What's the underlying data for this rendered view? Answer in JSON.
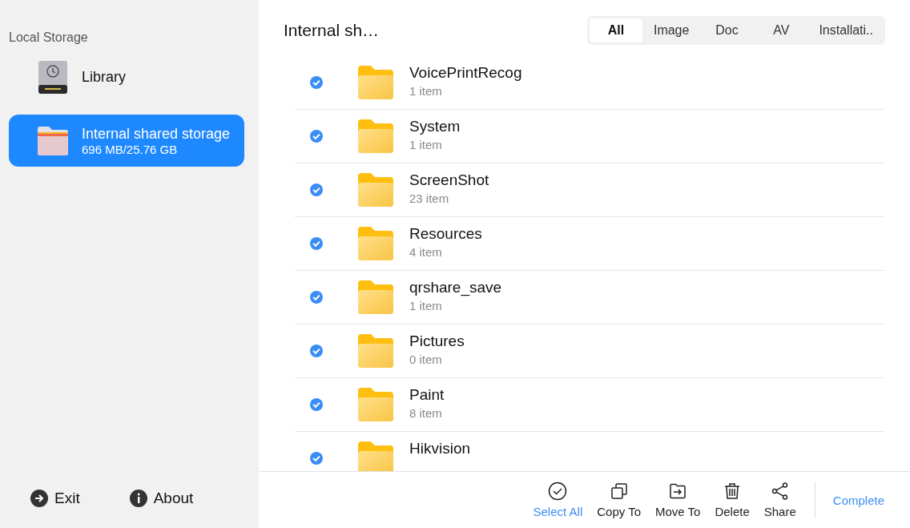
{
  "sidebar": {
    "heading": "Local Storage",
    "items": [
      {
        "kind": "library",
        "label": "Library",
        "selected": false
      },
      {
        "kind": "storage",
        "label": "Internal shared storage",
        "detail": "696 MB/25.76 GB",
        "selected": true
      }
    ],
    "footer": [
      {
        "kind": "exit",
        "label": "Exit"
      },
      {
        "kind": "about",
        "label": "About"
      }
    ]
  },
  "header": {
    "title": "Internal sh…",
    "tabs": [
      {
        "label": "All",
        "selected": true
      },
      {
        "label": "Image",
        "selected": false
      },
      {
        "label": "Doc",
        "selected": false
      },
      {
        "label": "AV",
        "selected": false
      },
      {
        "label": "Installati..",
        "selected": false
      }
    ]
  },
  "files": [
    {
      "name": "VoicePrintRecog",
      "detail": "1 item",
      "checked": true
    },
    {
      "name": "System",
      "detail": "1 item",
      "checked": true
    },
    {
      "name": "ScreenShot",
      "detail": "23 item",
      "checked": true
    },
    {
      "name": "Resources",
      "detail": "4 item",
      "checked": true
    },
    {
      "name": "qrshare_save",
      "detail": "1 item",
      "checked": true
    },
    {
      "name": "Pictures",
      "detail": "0 item",
      "checked": true
    },
    {
      "name": "Paint",
      "detail": "8 item",
      "checked": true
    },
    {
      "name": "Hikvision",
      "checked": true
    }
  ],
  "toolbar": {
    "actions": [
      {
        "kind": "select-all",
        "label": "Select All",
        "active": true
      },
      {
        "kind": "copy",
        "label": "Copy To",
        "active": false
      },
      {
        "kind": "move",
        "label": "Move To",
        "active": false
      },
      {
        "kind": "delete",
        "label": "Delete",
        "active": false
      },
      {
        "kind": "share",
        "label": "Share",
        "active": false
      }
    ],
    "complete": "Complete"
  }
}
